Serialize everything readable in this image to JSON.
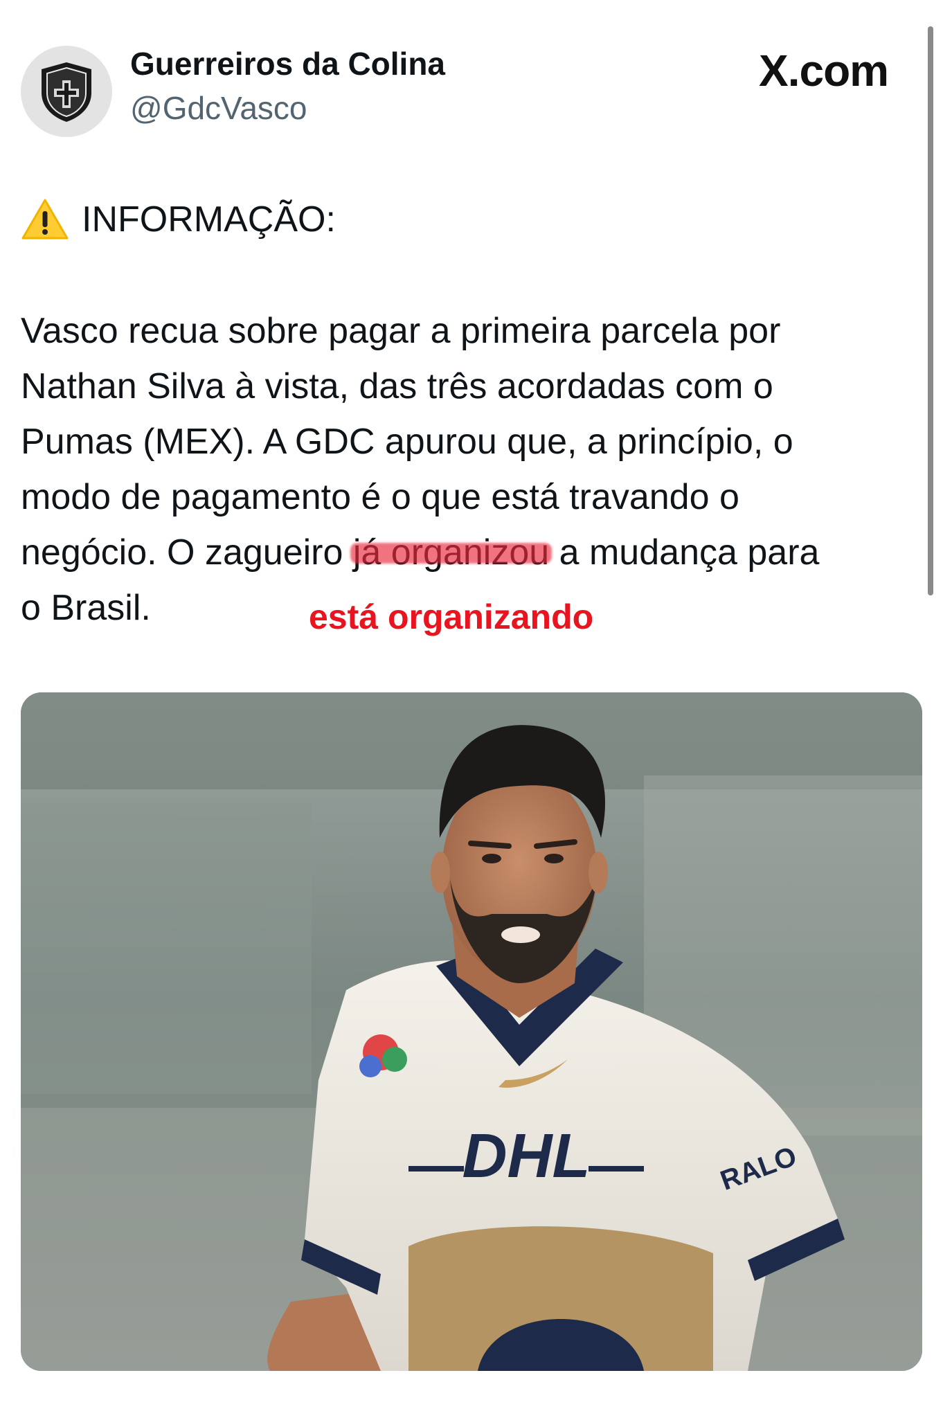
{
  "tweet": {
    "display_name": "Guerreiros da Colina",
    "handle": "@GdcVasco",
    "source": "X.com",
    "avatar_icon": "vasco-shield-icon",
    "info_icon": "warning-icon",
    "info_label": "INFORMAÇÃO:",
    "body": {
      "line1": "Vasco recua sobre pagar a primeira parcela por",
      "line2": "Nathan Silva à vista, das três acordadas com o",
      "line3": "Pumas (MEX). A GDC apurou que, a princípio, o",
      "line4": "modo de pagamento é o que está travando o",
      "line5_before": "negócio. O zagueiro ",
      "line5_struck": "já organizou",
      "line5_after": " a mudança para",
      "line6": "o Brasil."
    },
    "correction": "está organizando",
    "photo": {
      "subject": "player-photo",
      "shirt_text": "DHL",
      "sleeve_text": "RALO"
    }
  },
  "colors": {
    "correction_red": "#e8141f",
    "strike_red": "#eb283c",
    "handle_gray": "#536471"
  }
}
